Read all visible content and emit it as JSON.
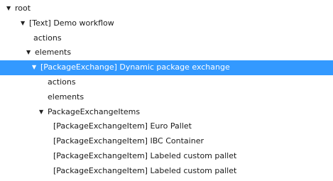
{
  "tree": {
    "root": {
      "label": "root",
      "expand_icon": "triangle-down-icon"
    },
    "workflow": {
      "label": "[Text] Demo workflow",
      "expand_icon": "triangle-down-icon"
    },
    "workflow_actions": {
      "label": "actions"
    },
    "workflow_elements": {
      "label": "elements",
      "expand_icon": "triangle-down-icon"
    },
    "package_exchange": {
      "label": "[PackageExchange] Dynamic package exchange",
      "expand_icon": "triangle-down-icon",
      "selected": true
    },
    "pe_actions": {
      "label": "actions"
    },
    "pe_elements": {
      "label": "elements"
    },
    "pe_items": {
      "label": "PackageExchangeItems",
      "expand_icon": "triangle-down-icon"
    },
    "items": [
      {
        "label": "[PackageExchangeItem] Euro Pallet"
      },
      {
        "label": "[PackageExchangeItem] IBC Container"
      },
      {
        "label": "[PackageExchangeItem] Labeled custom pallet"
      },
      {
        "label": "[PackageExchangeItem] Labeled custom pallet"
      }
    ]
  },
  "colors": {
    "selection": "#3399ff",
    "selected_text": "#ffffff",
    "text": "#1a1a1a"
  }
}
